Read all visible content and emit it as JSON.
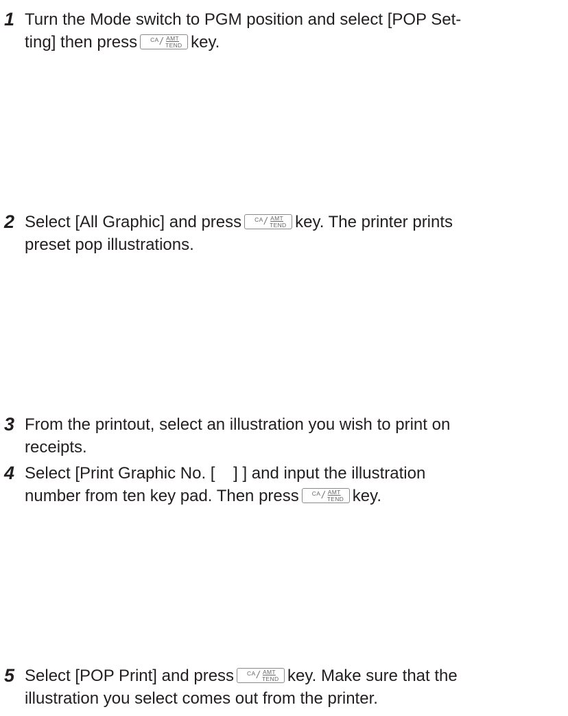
{
  "key_label": {
    "top_left": "CA",
    "top_right": "AMT",
    "bottom": "TEND"
  },
  "steps": [
    {
      "number": "1",
      "line1": "Turn the Mode switch to PGM position and select [POP Set-",
      "line2_a": "ting] then press",
      "line2_b": "key."
    },
    {
      "number": "2",
      "line1_a": "Select [All Graphic] and press",
      "line1_b": "key. The printer prints",
      "line2": "preset pop illustrations."
    },
    {
      "number": "3",
      "line1": "From the printout, select an illustration you wish to print on",
      "line2": "receipts."
    },
    {
      "number": "4",
      "line1": "Select [Print Graphic No. [    ] ] and input the illustration",
      "line2_a": "number from ten key pad. Then press",
      "line2_b": "key."
    },
    {
      "number": "5",
      "line1_a": "Select [POP Print] and press",
      "line1_b": "key. Make sure that the",
      "line2": "illustration you select comes out from the printer."
    }
  ]
}
